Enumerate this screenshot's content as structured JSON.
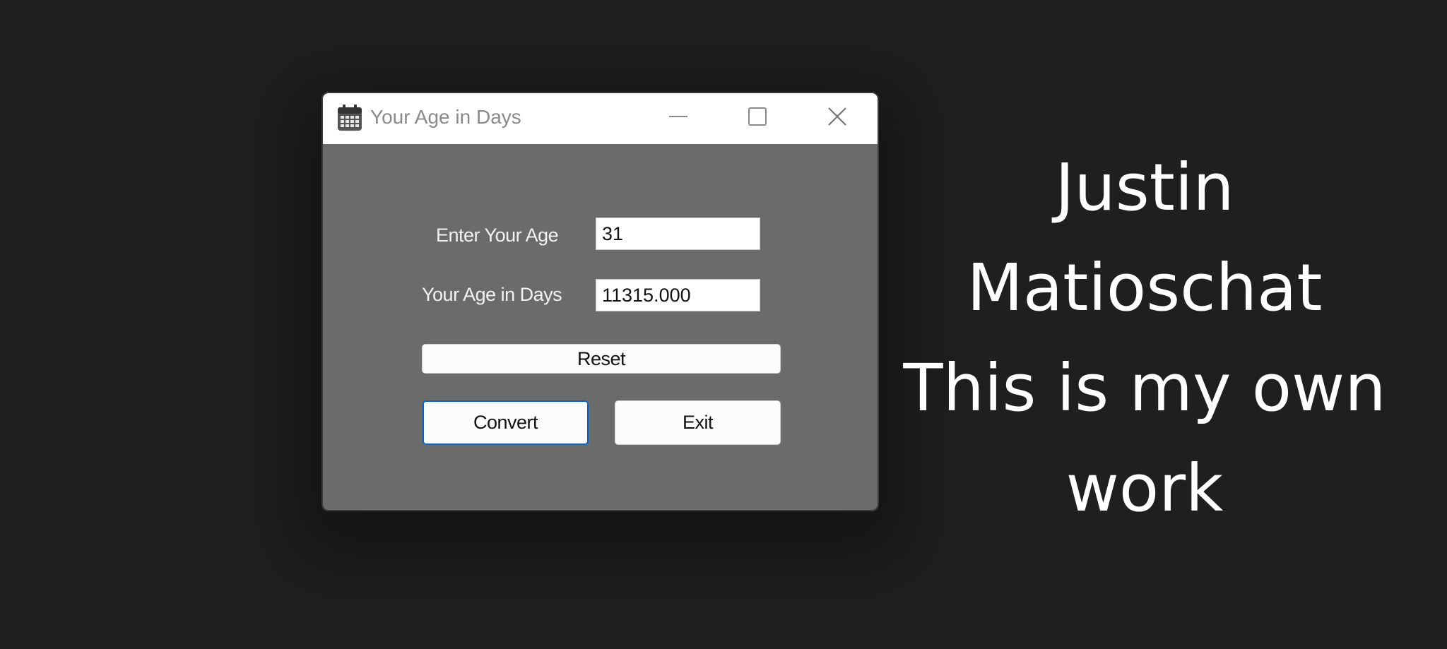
{
  "window": {
    "title": "Your Age in Days",
    "icon": "calendar-icon"
  },
  "form": {
    "age_label": "Enter Your Age",
    "age_value": "31",
    "days_label": "Your Age in Days",
    "days_value": "11315.000"
  },
  "buttons": {
    "reset": "Reset",
    "convert": "Convert",
    "exit": "Exit"
  },
  "side_text": {
    "line1": "Justin",
    "line2": "Matioschat",
    "line3": "This is my own",
    "line4": "work"
  },
  "colors": {
    "background": "#1f1f1f",
    "form_background": "#6b6b6b",
    "focus_border": "#0a64c8"
  }
}
